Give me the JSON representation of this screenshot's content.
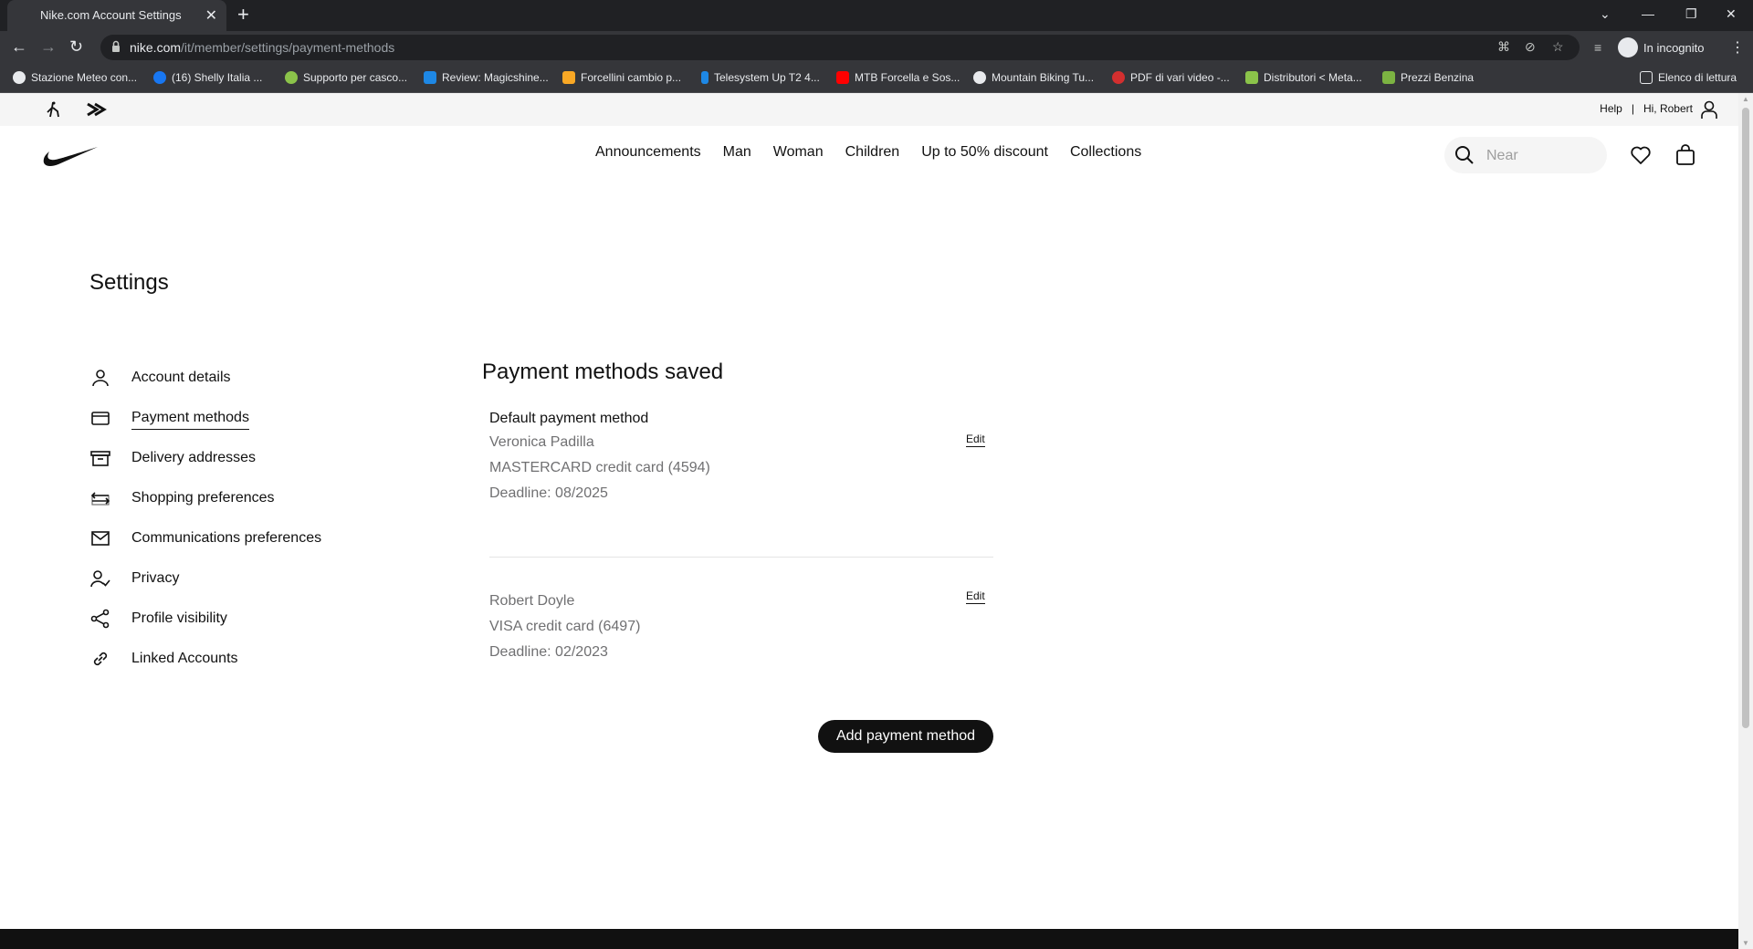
{
  "browser": {
    "tab_title": "Nike.com Account Settings",
    "url_host": "nike.com",
    "url_path": "/it/member/settings/payment-methods",
    "incognito_label": "In incognito",
    "bookmarks": [
      {
        "label": "Stazione Meteo con...",
        "color": "#e8eaed"
      },
      {
        "label": "(16) Shelly Italia ...",
        "color": "#1877f2"
      },
      {
        "label": "Supporto per casco...",
        "color": "#8bc34a"
      },
      {
        "label": "Review: Magicshine...",
        "color": "#1e88e5"
      },
      {
        "label": "Forcellini cambio p...",
        "color": "#f9a825"
      },
      {
        "label": "Telesystem Up T2 4...",
        "color": "#1e88e5"
      },
      {
        "label": "MTB Forcella e Sos...",
        "color": "#ff0000"
      },
      {
        "label": "Mountain Biking Tu...",
        "color": "#e8eaed"
      },
      {
        "label": "PDF di vari video -...",
        "color": "#d32f2f"
      },
      {
        "label": "Distributori < Meta...",
        "color": "#8bc34a"
      },
      {
        "label": "Prezzi Benzina",
        "color": "#7cb342"
      }
    ],
    "reading_list": "Elenco di lettura"
  },
  "site": {
    "help": "Help",
    "separator": "|",
    "greeting": "Hi, Robert",
    "menu": [
      "Announcements",
      "Man",
      "Woman",
      "Children",
      "Up to 50% discount",
      "Collections"
    ],
    "search_placeholder": "Near"
  },
  "settings": {
    "title": "Settings",
    "sidebar": [
      {
        "label": "Account details",
        "icon": "user-icon"
      },
      {
        "label": "Payment methods",
        "icon": "card-icon",
        "active": true
      },
      {
        "label": "Delivery addresses",
        "icon": "box-icon"
      },
      {
        "label": "Shopping preferences",
        "icon": "shopping-icon"
      },
      {
        "label": "Communications preferences",
        "icon": "mail-icon"
      },
      {
        "label": "Privacy",
        "icon": "privacy-icon"
      },
      {
        "label": "Profile visibility",
        "icon": "share-icon"
      },
      {
        "label": "Linked Accounts",
        "icon": "link-icon"
      }
    ]
  },
  "payments": {
    "title": "Payment methods saved",
    "default_label": "Default payment method",
    "cards": [
      {
        "name": "Veronica Padilla",
        "card": "MASTERCARD credit card (4594)",
        "deadline": "Deadline: 08/2025",
        "edit": "Edit"
      },
      {
        "name": "Robert Doyle",
        "card": "VISA credit card (6497)",
        "deadline": "Deadline: 02/2023",
        "edit": "Edit"
      }
    ],
    "add_button": "Add payment method"
  }
}
